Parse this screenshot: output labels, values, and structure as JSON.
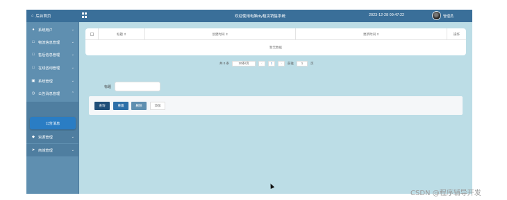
{
  "topbar": {
    "home_label": "后台首页",
    "title": "欢迎使用电脑diy租赁销售系统",
    "datetime": "2023-12-28 09:47:22",
    "user": "管理员",
    "home_icon": "home-icon",
    "menu_icon": "grid-icon"
  },
  "sidebar": {
    "items": [
      {
        "label": "系统用户",
        "icon": "user-icon"
      },
      {
        "label": "物流信息管理",
        "icon": "external-link-icon"
      },
      {
        "label": "售后信息管理",
        "icon": "external-link-icon"
      },
      {
        "label": "在线咨询管理",
        "icon": "external-link-icon"
      },
      {
        "label": "系统管理",
        "icon": "monitor-icon"
      },
      {
        "label": "公告消息管理",
        "icon": "clock-icon"
      },
      {
        "label": "资源管理",
        "icon": "shield-icon"
      },
      {
        "label": "商城管理",
        "icon": "cart-icon"
      }
    ],
    "sub_item": "公告消息"
  },
  "table": {
    "columns": [
      "标题 ⇕",
      "创建时间 ⇕",
      "更新时间 ⇕",
      "操作"
    ],
    "empty_text": "暂无数据"
  },
  "pager": {
    "total": "共 0 条",
    "page_size": "10条/页",
    "prev": "‹",
    "page": "1",
    "next": "›",
    "goto_prefix": "前往",
    "goto_value": "1",
    "goto_suffix": "页"
  },
  "search": {
    "label": "标题",
    "placeholder": ""
  },
  "actions": {
    "query": "查询",
    "reset": "重置",
    "delete": "删除",
    "add": "添加"
  },
  "colors": {
    "topbar": "#3a6f99",
    "sidebar": "#5f8fb0",
    "content": "#bcdde6",
    "active_sub": "#2a7dc4"
  },
  "watermark": "CSDN @程序辅导开发"
}
